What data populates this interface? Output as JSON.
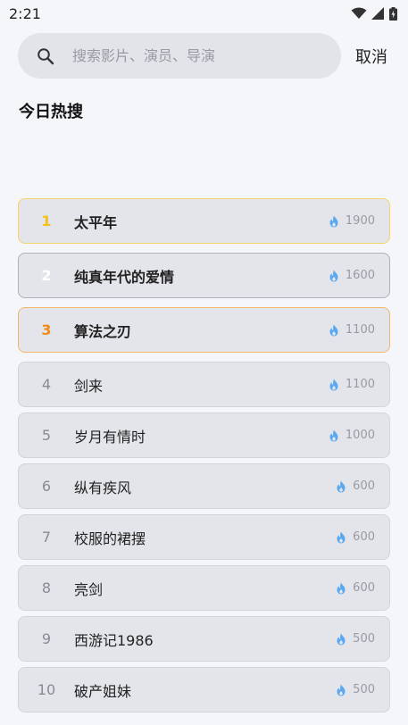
{
  "status": {
    "time": "2:21"
  },
  "search": {
    "placeholder": "搜索影片、演员、导演",
    "value": "",
    "cancel_label": "取消"
  },
  "section": {
    "title": "今日热搜"
  },
  "hot_list": [
    {
      "rank": "1",
      "title": "太平年",
      "heat": "1900"
    },
    {
      "rank": "2",
      "title": "纯真年代的爱情",
      "heat": "1600"
    },
    {
      "rank": "3",
      "title": "算法之刃",
      "heat": "1100"
    },
    {
      "rank": "4",
      "title": "剑来",
      "heat": "1100"
    },
    {
      "rank": "5",
      "title": "岁月有情时",
      "heat": "1000"
    },
    {
      "rank": "6",
      "title": "纵有疾风",
      "heat": "600"
    },
    {
      "rank": "7",
      "title": "校服的裙摆",
      "heat": "600"
    },
    {
      "rank": "8",
      "title": "亮剑",
      "heat": "600"
    },
    {
      "rank": "9",
      "title": "西游记1986",
      "heat": "500"
    },
    {
      "rank": "10",
      "title": "破产姐妹",
      "heat": "500"
    }
  ],
  "colors": {
    "gold": "#f4c01e",
    "silver": "#ffffff",
    "bronze": "#f08c15",
    "flame": "#5aa9f0"
  }
}
